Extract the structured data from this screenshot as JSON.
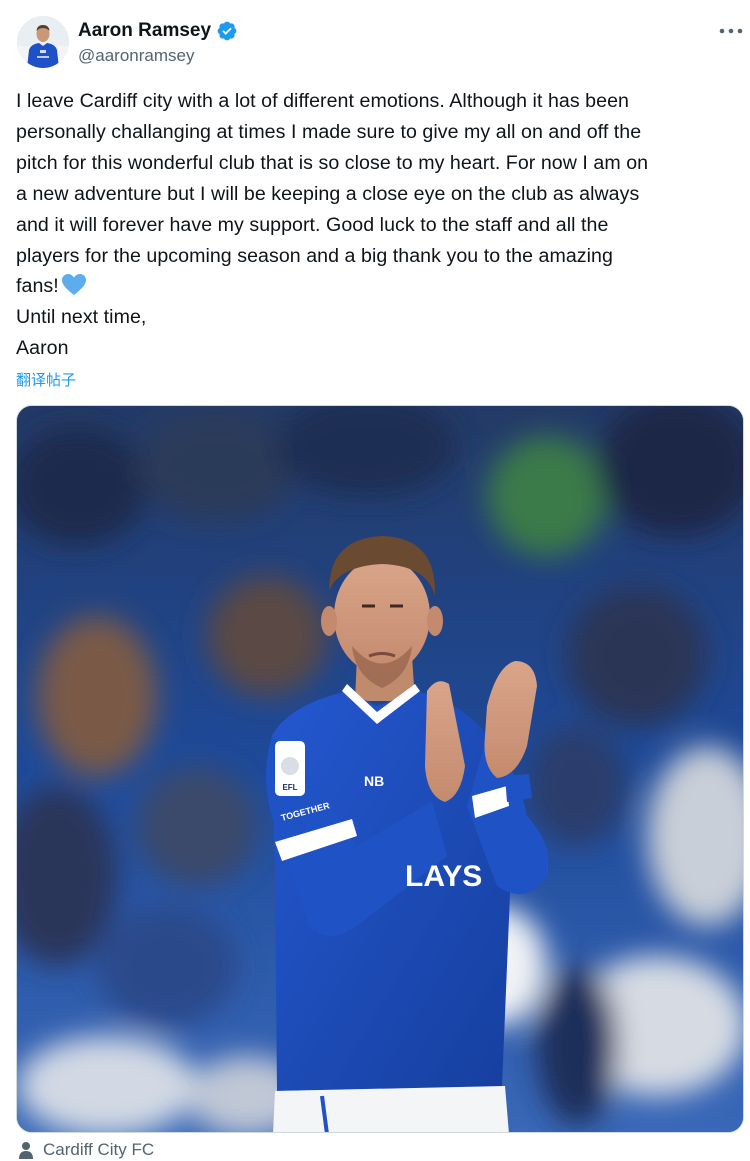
{
  "author": {
    "name": "Aaron Ramsey",
    "handle": "@aaronramsey",
    "verified_icon": "verified-badge-icon",
    "accent_color": "#1d9bf0"
  },
  "menu": {
    "icon": "more-options-icon"
  },
  "tweet": {
    "text_lines": [
      "I leave Cardiff city with a lot of different emotions. Although it has been",
      "personally challanging at times I made sure to give my all on and off the",
      "pitch for this wonderful club that is so close to my heart. For now I am on",
      "a new adventure but I will be keeping a close eye on the club as always",
      "and it will forever have my support. Good luck to the staff and all the",
      "players for the upcoming season and a big thank you to the amazing",
      "fans!",
      "Until next time,",
      "Aaron"
    ],
    "emoji": "blue-heart-emoji",
    "translate_label": "翻译帖子"
  },
  "media": {
    "kit_sponsor_text": "LAYS",
    "badge_text": "EFL",
    "sleeve_text": "TOGETHER",
    "colors": {
      "kit_blue": "#1d4fc4",
      "crowd_dark": "#1a2a4e"
    }
  },
  "location": {
    "icon": "location-person-icon",
    "label": "Cardiff City FC"
  }
}
